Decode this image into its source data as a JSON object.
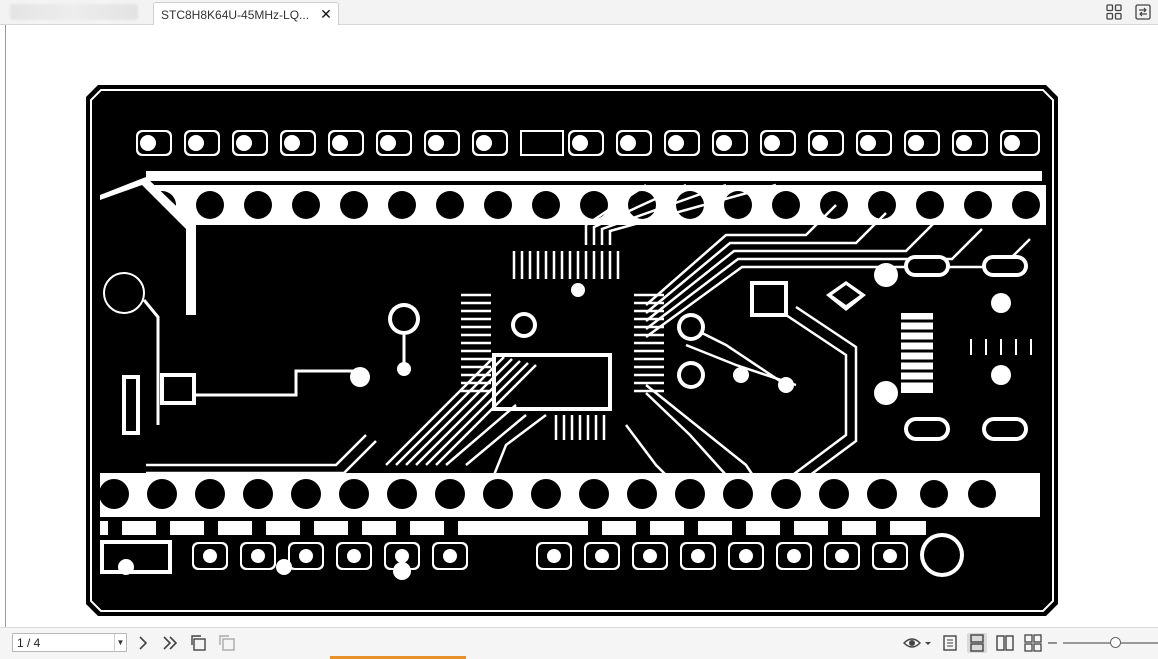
{
  "tab_bar": {
    "active_tab_title": "STC8H8K64U-45MHz-LQ...",
    "close_icon": "close-icon",
    "right_icons": [
      "grid-view-icon",
      "export-icon"
    ]
  },
  "document": {
    "content": "pcb-layout-image",
    "colors": {
      "copper": "#000000",
      "clearance": "#ffffff"
    }
  },
  "bottom_bar": {
    "page_indicator": "1 / 4",
    "nav_icons": [
      "next-page-icon",
      "last-page-icon",
      "rotate-page-icon",
      "copy-page-icon"
    ],
    "view_icons": [
      "eye-icon",
      "single-page-icon",
      "continuous-page-icon",
      "two-page-icon",
      "two-page-continuous-icon"
    ],
    "zoom_level_fraction": 0.55
  }
}
